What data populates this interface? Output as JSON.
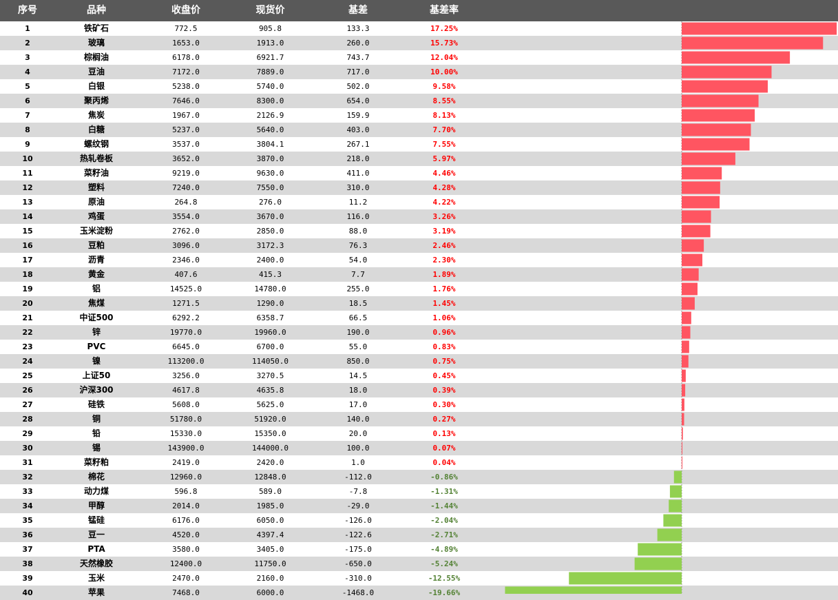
{
  "headers": {
    "idx": "序号",
    "name": "品种",
    "close": "收盘价",
    "spot": "现货价",
    "basis": "基差",
    "rate": "基差率"
  },
  "colors": {
    "header_bg": "#595959",
    "pos_bar": "#ff5561",
    "neg_bar": "#92d050",
    "pos_text": "#ff0000",
    "neg_text": "#548235",
    "alt_row": "#d9d9d9"
  },
  "chart_data": {
    "type": "bar",
    "orientation": "horizontal",
    "title": "",
    "categories": [
      "铁矿石",
      "玻璃",
      "棕榈油",
      "豆油",
      "白银",
      "聚丙烯",
      "焦炭",
      "白糖",
      "螺纹钢",
      "热轧卷板",
      "菜籽油",
      "塑料",
      "原油",
      "鸡蛋",
      "玉米淀粉",
      "豆粕",
      "沥青",
      "黄金",
      "铝",
      "焦煤",
      "中证500",
      "锌",
      "PVC",
      "镍",
      "上证50",
      "沪深300",
      "硅铁",
      "铜",
      "铅",
      "锡",
      "菜籽粕",
      "棉花",
      "动力煤",
      "甲醇",
      "锰硅",
      "豆一",
      "PTA",
      "天然橡胶",
      "玉米",
      "苹果"
    ],
    "series": [
      {
        "values": [
          17.25,
          15.73,
          12.04,
          10.0,
          9.58,
          8.55,
          8.13,
          7.7,
          7.55,
          5.97,
          4.46,
          4.28,
          4.22,
          3.26,
          3.19,
          2.46,
          2.3,
          1.89,
          1.76,
          1.45,
          1.06,
          0.96,
          0.83,
          0.75,
          0.45,
          0.39,
          0.3,
          0.27,
          0.13,
          0.07,
          0.04,
          -0.86,
          -1.31,
          -1.44,
          -2.04,
          -2.71,
          -4.89,
          -5.24,
          -12.55,
          -19.66
        ]
      }
    ]
  },
  "rows": [
    {
      "idx": "1",
      "name": "铁矿石",
      "close": "772.5",
      "spot": "905.8",
      "basis": "133.3",
      "rate": "17.25%"
    },
    {
      "idx": "2",
      "name": "玻璃",
      "close": "1653.0",
      "spot": "1913.0",
      "basis": "260.0",
      "rate": "15.73%"
    },
    {
      "idx": "3",
      "name": "棕榈油",
      "close": "6178.0",
      "spot": "6921.7",
      "basis": "743.7",
      "rate": "12.04%"
    },
    {
      "idx": "4",
      "name": "豆油",
      "close": "7172.0",
      "spot": "7889.0",
      "basis": "717.0",
      "rate": "10.00%"
    },
    {
      "idx": "5",
      "name": "白银",
      "close": "5238.0",
      "spot": "5740.0",
      "basis": "502.0",
      "rate": "9.58%"
    },
    {
      "idx": "6",
      "name": "聚丙烯",
      "close": "7646.0",
      "spot": "8300.0",
      "basis": "654.0",
      "rate": "8.55%"
    },
    {
      "idx": "7",
      "name": "焦炭",
      "close": "1967.0",
      "spot": "2126.9",
      "basis": "159.9",
      "rate": "8.13%"
    },
    {
      "idx": "8",
      "name": "白糖",
      "close": "5237.0",
      "spot": "5640.0",
      "basis": "403.0",
      "rate": "7.70%"
    },
    {
      "idx": "9",
      "name": "螺纹钢",
      "close": "3537.0",
      "spot": "3804.1",
      "basis": "267.1",
      "rate": "7.55%"
    },
    {
      "idx": "10",
      "name": "热轧卷板",
      "close": "3652.0",
      "spot": "3870.0",
      "basis": "218.0",
      "rate": "5.97%"
    },
    {
      "idx": "11",
      "name": "菜籽油",
      "close": "9219.0",
      "spot": "9630.0",
      "basis": "411.0",
      "rate": "4.46%"
    },
    {
      "idx": "12",
      "name": "塑料",
      "close": "7240.0",
      "spot": "7550.0",
      "basis": "310.0",
      "rate": "4.28%"
    },
    {
      "idx": "13",
      "name": "原油",
      "close": "264.8",
      "spot": "276.0",
      "basis": "11.2",
      "rate": "4.22%"
    },
    {
      "idx": "14",
      "name": "鸡蛋",
      "close": "3554.0",
      "spot": "3670.0",
      "basis": "116.0",
      "rate": "3.26%"
    },
    {
      "idx": "15",
      "name": "玉米淀粉",
      "close": "2762.0",
      "spot": "2850.0",
      "basis": "88.0",
      "rate": "3.19%"
    },
    {
      "idx": "16",
      "name": "豆粕",
      "close": "3096.0",
      "spot": "3172.3",
      "basis": "76.3",
      "rate": "2.46%"
    },
    {
      "idx": "17",
      "name": "沥青",
      "close": "2346.0",
      "spot": "2400.0",
      "basis": "54.0",
      "rate": "2.30%"
    },
    {
      "idx": "18",
      "name": "黄金",
      "close": "407.6",
      "spot": "415.3",
      "basis": "7.7",
      "rate": "1.89%"
    },
    {
      "idx": "19",
      "name": "铝",
      "close": "14525.0",
      "spot": "14780.0",
      "basis": "255.0",
      "rate": "1.76%"
    },
    {
      "idx": "20",
      "name": "焦煤",
      "close": "1271.5",
      "spot": "1290.0",
      "basis": "18.5",
      "rate": "1.45%"
    },
    {
      "idx": "21",
      "name": "中证500",
      "close": "6292.2",
      "spot": "6358.7",
      "basis": "66.5",
      "rate": "1.06%"
    },
    {
      "idx": "22",
      "name": "锌",
      "close": "19770.0",
      "spot": "19960.0",
      "basis": "190.0",
      "rate": "0.96%"
    },
    {
      "idx": "23",
      "name": "PVC",
      "close": "6645.0",
      "spot": "6700.0",
      "basis": "55.0",
      "rate": "0.83%"
    },
    {
      "idx": "24",
      "name": "镍",
      "close": "113200.0",
      "spot": "114050.0",
      "basis": "850.0",
      "rate": "0.75%"
    },
    {
      "idx": "25",
      "name": "上证50",
      "close": "3256.0",
      "spot": "3270.5",
      "basis": "14.5",
      "rate": "0.45%"
    },
    {
      "idx": "26",
      "name": "沪深300",
      "close": "4617.8",
      "spot": "4635.8",
      "basis": "18.0",
      "rate": "0.39%"
    },
    {
      "idx": "27",
      "name": "硅铁",
      "close": "5608.0",
      "spot": "5625.0",
      "basis": "17.0",
      "rate": "0.30%"
    },
    {
      "idx": "28",
      "name": "铜",
      "close": "51780.0",
      "spot": "51920.0",
      "basis": "140.0",
      "rate": "0.27%"
    },
    {
      "idx": "29",
      "name": "铅",
      "close": "15330.0",
      "spot": "15350.0",
      "basis": "20.0",
      "rate": "0.13%"
    },
    {
      "idx": "30",
      "name": "锡",
      "close": "143900.0",
      "spot": "144000.0",
      "basis": "100.0",
      "rate": "0.07%"
    },
    {
      "idx": "31",
      "name": "菜籽粕",
      "close": "2419.0",
      "spot": "2420.0",
      "basis": "1.0",
      "rate": "0.04%"
    },
    {
      "idx": "32",
      "name": "棉花",
      "close": "12960.0",
      "spot": "12848.0",
      "basis": "-112.0",
      "rate": "-0.86%"
    },
    {
      "idx": "33",
      "name": "动力煤",
      "close": "596.8",
      "spot": "589.0",
      "basis": "-7.8",
      "rate": "-1.31%"
    },
    {
      "idx": "34",
      "name": "甲醇",
      "close": "2014.0",
      "spot": "1985.0",
      "basis": "-29.0",
      "rate": "-1.44%"
    },
    {
      "idx": "35",
      "name": "锰硅",
      "close": "6176.0",
      "spot": "6050.0",
      "basis": "-126.0",
      "rate": "-2.04%"
    },
    {
      "idx": "36",
      "name": "豆一",
      "close": "4520.0",
      "spot": "4397.4",
      "basis": "-122.6",
      "rate": "-2.71%"
    },
    {
      "idx": "37",
      "name": "PTA",
      "close": "3580.0",
      "spot": "3405.0",
      "basis": "-175.0",
      "rate": "-4.89%"
    },
    {
      "idx": "38",
      "name": "天然橡胶",
      "close": "12400.0",
      "spot": "11750.0",
      "basis": "-650.0",
      "rate": "-5.24%"
    },
    {
      "idx": "39",
      "name": "玉米",
      "close": "2470.0",
      "spot": "2160.0",
      "basis": "-310.0",
      "rate": "-12.55%"
    },
    {
      "idx": "40",
      "name": "苹果",
      "close": "7468.0",
      "spot": "6000.0",
      "basis": "-1468.0",
      "rate": "-19.66%"
    }
  ]
}
